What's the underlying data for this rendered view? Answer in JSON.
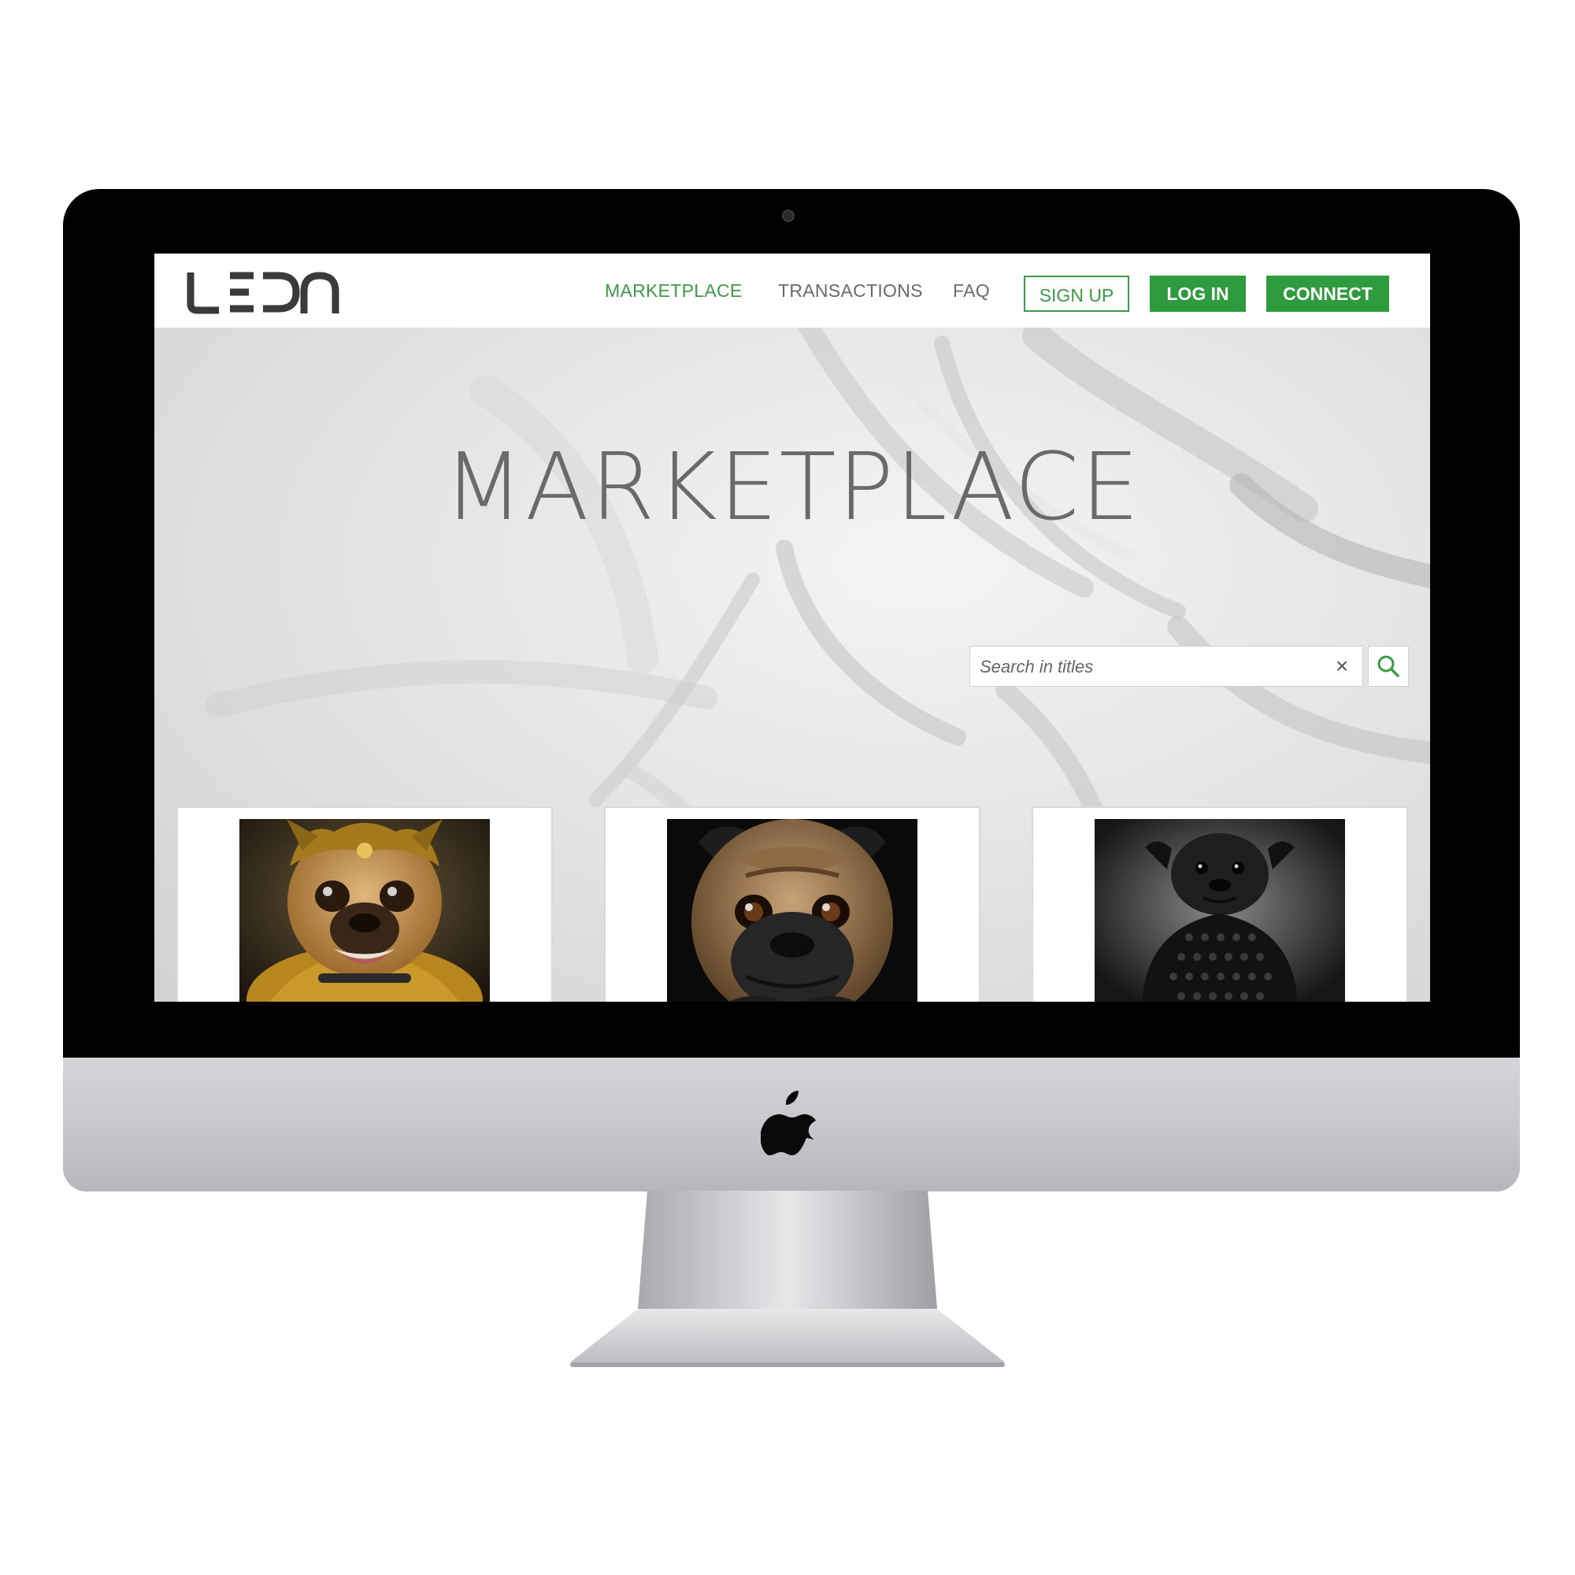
{
  "nav": {
    "logo_text": "LEDN",
    "links": [
      {
        "label": "MARKETPLACE",
        "active": true
      },
      {
        "label": "TRANSACTIONS",
        "active": false
      },
      {
        "label": "FAQ",
        "active": false
      }
    ],
    "signup_label": "SIGN UP",
    "login_label": "LOG IN",
    "connect_label": "CONNECT"
  },
  "hero": {
    "title": "MARKETPLACE"
  },
  "search": {
    "placeholder": "Search in titles",
    "clear_icon": "close-icon",
    "search_icon": "search-icon"
  },
  "cards": [
    {
      "image": "pug-gold-ornate-armor"
    },
    {
      "image": "pug-dark-closeup"
    },
    {
      "image": "pug-black-armor"
    }
  ],
  "colors": {
    "accent": "#2f9b3f",
    "accent_text": "#3e9a48",
    "bezel": "#000000",
    "chin": "#c6c7ca"
  }
}
